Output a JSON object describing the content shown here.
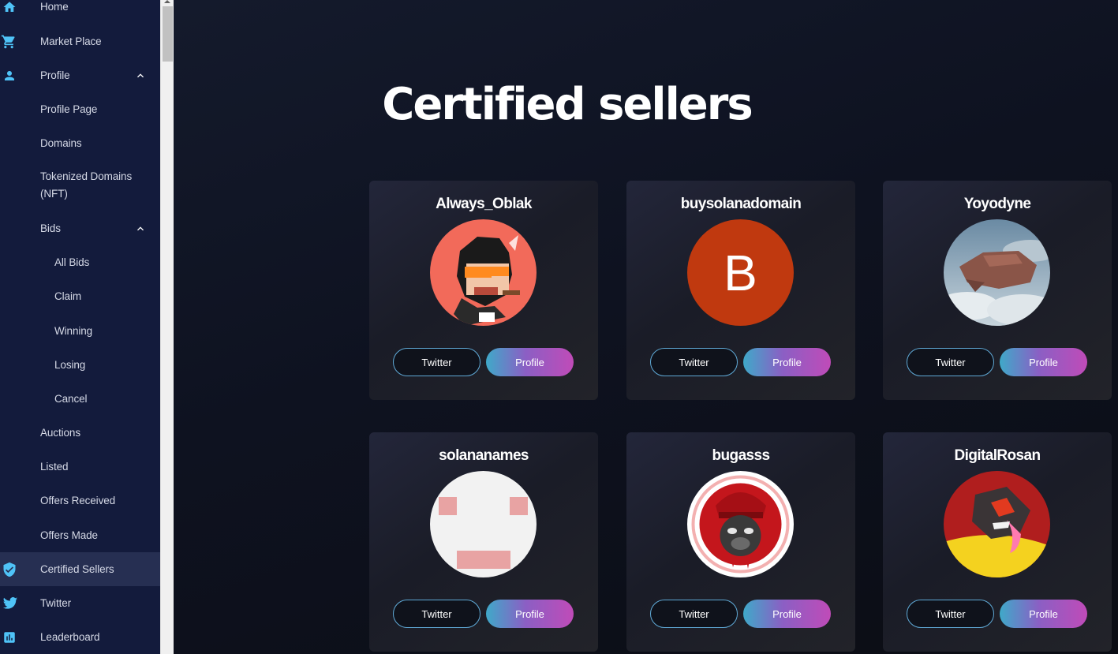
{
  "sidebar": {
    "items": [
      {
        "label": "Home",
        "icon": "home-icon"
      },
      {
        "label": "Market Place",
        "icon": "cart-icon"
      },
      {
        "label": "Profile",
        "icon": "person-icon"
      },
      {
        "label": "Profile Page"
      },
      {
        "label": "Domains"
      },
      {
        "label": "Tokenized Domains (NFT)"
      },
      {
        "label": "Bids"
      },
      {
        "label": "All Bids"
      },
      {
        "label": "Claim"
      },
      {
        "label": "Winning"
      },
      {
        "label": "Losing"
      },
      {
        "label": "Cancel"
      },
      {
        "label": "Auctions"
      },
      {
        "label": "Listed"
      },
      {
        "label": "Offers Received"
      },
      {
        "label": "Offers Made"
      },
      {
        "label": "Certified Sellers",
        "icon": "shield-check-icon",
        "active": true
      },
      {
        "label": "Twitter",
        "icon": "twitter-icon"
      },
      {
        "label": "Leaderboard",
        "icon": "bar-chart-icon"
      }
    ]
  },
  "main": {
    "title": "Certified sellers",
    "sellers": [
      {
        "name": "Always_Oblak",
        "twitter_label": "Twitter",
        "profile_label": "Profile"
      },
      {
        "name": "buysolanadomain",
        "avatar_letter": "B",
        "twitter_label": "Twitter",
        "profile_label": "Profile"
      },
      {
        "name": "Yoyodyne",
        "twitter_label": "Twitter",
        "profile_label": "Profile"
      },
      {
        "name": "solananames",
        "twitter_label": "Twitter",
        "profile_label": "Profile"
      },
      {
        "name": "bugasss",
        "twitter_label": "Twitter",
        "profile_label": "Profile"
      },
      {
        "name": "DigitalRosan",
        "twitter_label": "Twitter",
        "profile_label": "Profile"
      }
    ]
  },
  "colors": {
    "sidebar_bg": "#131b3c",
    "accent_icon": "#4fc3f7",
    "main_bg": "#0e1220",
    "profile_gradient_start": "#3fa9c9",
    "profile_gradient_end": "#c04bb8"
  }
}
